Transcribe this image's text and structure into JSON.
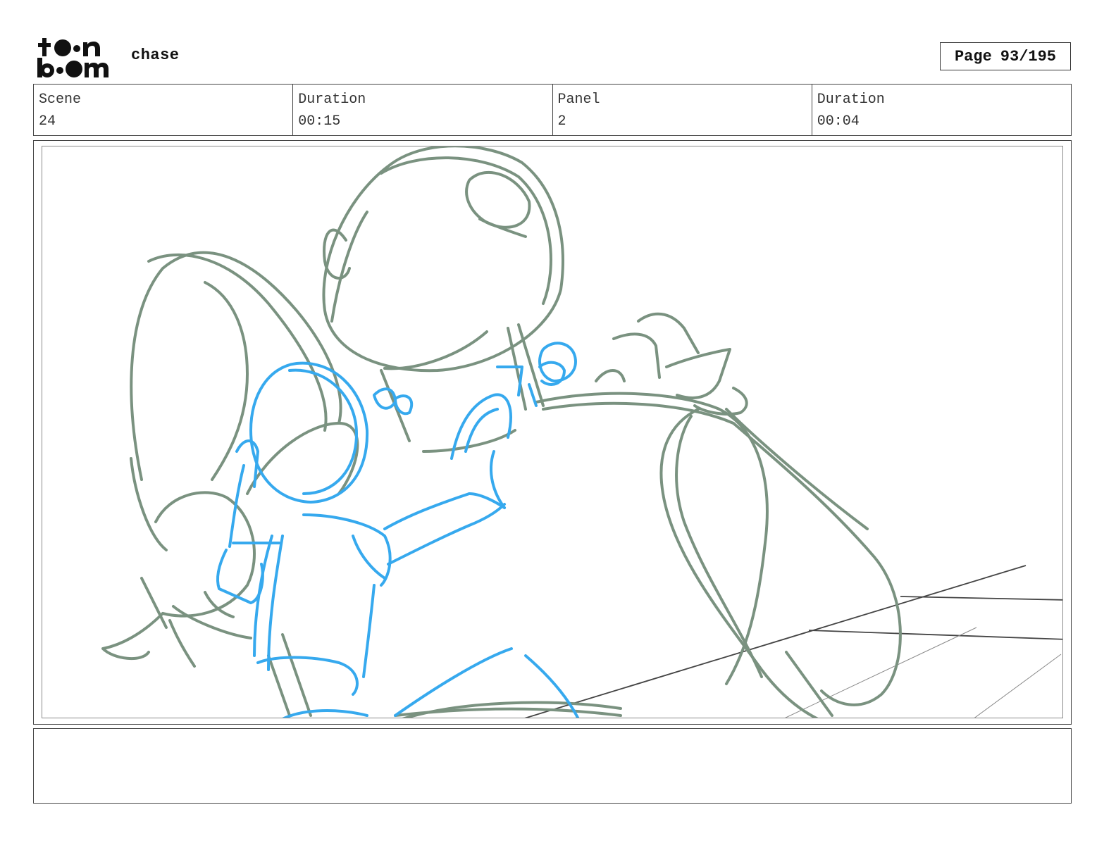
{
  "header": {
    "logo_text": "toonboom",
    "project_title": "chase",
    "page_label": "Page",
    "page_value": "93/195"
  },
  "info": {
    "scene_label": "Scene",
    "scene_value": "24",
    "scene_duration_label": "Duration",
    "scene_duration_value": "00:15",
    "panel_label": "Panel",
    "panel_value": "2",
    "panel_duration_label": "Duration",
    "panel_duration_value": "00:04"
  },
  "notes": {
    "text": ""
  },
  "colors": {
    "rough_sketch": "#7a9280",
    "clean_sketch": "#36a9ee",
    "perspective_lines": "#444444"
  }
}
